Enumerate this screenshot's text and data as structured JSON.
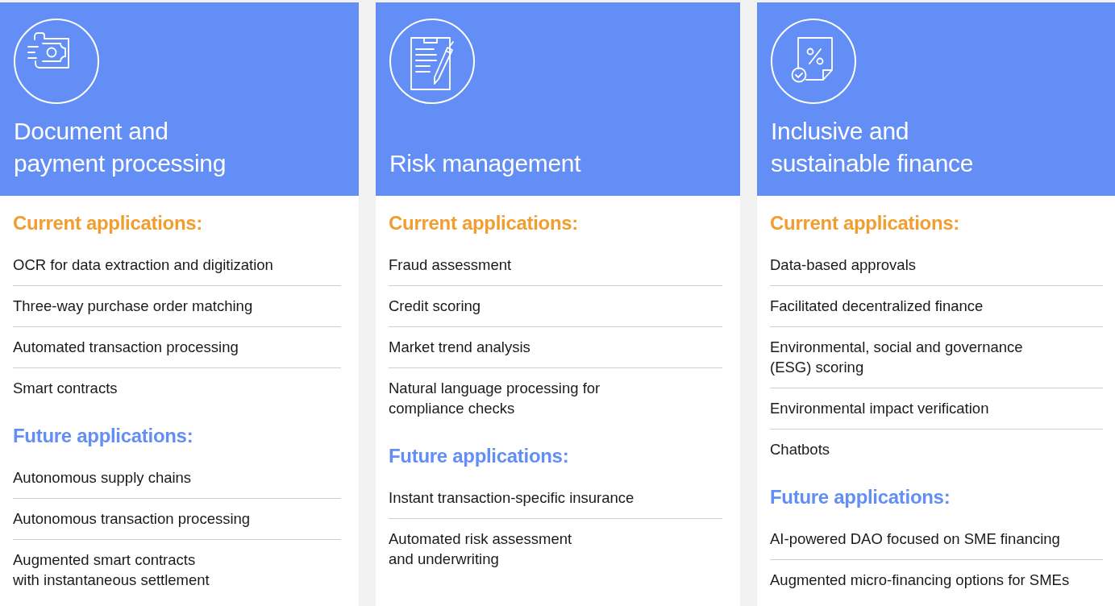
{
  "cards": [
    {
      "kind": "banknote",
      "title": "Document and\npayment processing",
      "sections": [
        {
          "kind": "current",
          "heading": "Current applications:",
          "items": [
            "OCR for data extraction and digitization",
            "Three-way purchase order matching",
            "Automated transaction processing",
            "Smart contracts"
          ]
        },
        {
          "kind": "future",
          "heading": "Future applications:",
          "items": [
            "Autonomous supply chains",
            "Autonomous transaction processing",
            "Augmented smart contracts\nwith instantaneous settlement"
          ]
        }
      ]
    },
    {
      "kind": "clipboard",
      "title": "Risk management",
      "sections": [
        {
          "kind": "current",
          "heading": "Current applications:",
          "items": [
            "Fraud assessment",
            "Credit scoring",
            "Market trend analysis",
            "Natural language processing for\ncompliance checks"
          ]
        },
        {
          "kind": "future",
          "heading": "Future applications:",
          "items": [
            "Instant transaction-specific insurance",
            "Automated risk assessment\nand underwriting"
          ]
        }
      ]
    },
    {
      "kind": "percent-document",
      "title": "Inclusive and\nsustainable finance",
      "sections": [
        {
          "kind": "current",
          "heading": "Current applications:",
          "items": [
            "Data-based approvals",
            "Facilitated decentralized finance",
            "Environmental, social and governance\n(ESG) scoring",
            "Environmental impact verification",
            "Chatbots"
          ]
        },
        {
          "kind": "future",
          "heading": "Future applications:",
          "items": [
            "AI-powered DAO focused on SME financing",
            "Augmented micro-financing options for SMEs"
          ]
        }
      ]
    }
  ]
}
